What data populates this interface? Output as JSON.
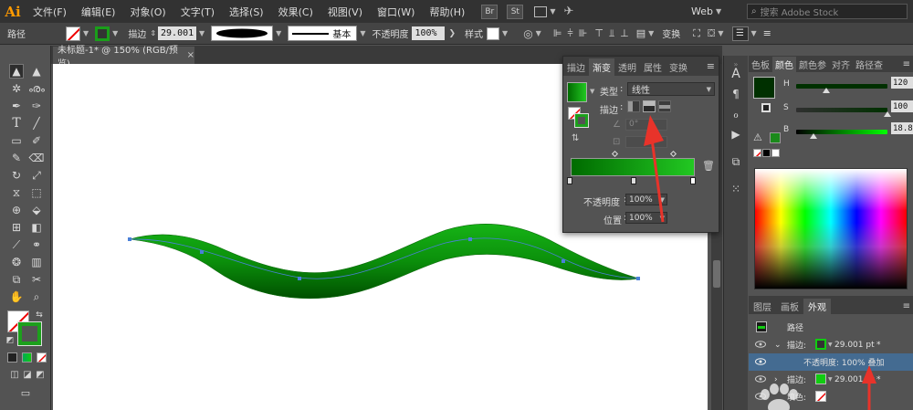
{
  "menubar": {
    "logo": "Ai",
    "items": [
      "文件(F)",
      "编辑(E)",
      "对象(O)",
      "文字(T)",
      "选择(S)",
      "效果(C)",
      "视图(V)",
      "窗口(W)",
      "帮助(H)"
    ],
    "badges": [
      "Br",
      "St"
    ],
    "workspace": "Web",
    "search_placeholder": "搜索 Adobe Stock"
  },
  "controlbar": {
    "object_type": "路径",
    "stroke_label": "描边",
    "stroke_value": "29.001",
    "brush_label": "基本",
    "opacity_label": "不透明度",
    "opacity_value": "100%",
    "style_label": "样式",
    "transform_label": "变换"
  },
  "document": {
    "tab_title": "未标题-1* @ 150% (RGB/预览)",
    "close_glyph": "×"
  },
  "gradient_panel": {
    "tabs": [
      "描边",
      "渐变",
      "透明",
      "属性",
      "变换"
    ],
    "active_tab": "渐变",
    "type_label": "类型",
    "type_value": "线性",
    "stroke_label": "描边",
    "angle_value": "0°",
    "opacity_label": "不透明度",
    "opacity_value": "100%",
    "location_label": "位置",
    "location_value": "100%",
    "stop_dark": "#006b00",
    "stop_light": "#22c822"
  },
  "color_panel": {
    "tabs": [
      "色板",
      "颜色",
      "颜色参",
      "对齐",
      "路径查"
    ],
    "active_tab": "颜色",
    "channels": [
      {
        "label": "H",
        "value": "120",
        "unit": "°",
        "fraction": 0.33
      },
      {
        "label": "S",
        "value": "100",
        "unit": "%",
        "fraction": 1.0
      },
      {
        "label": "B",
        "value": "18.82",
        "unit": "%",
        "fraction": 0.19
      }
    ],
    "current_color": "#003000"
  },
  "appearance_panel": {
    "tabs": [
      "图层",
      "画板",
      "外观"
    ],
    "active_tab": "外观",
    "title": "路径",
    "rows": [
      {
        "label": "描边:",
        "value": "29.001 pt",
        "mark": "*"
      },
      {
        "label": "不透明度: 100% 叠加",
        "value": "",
        "mark": ""
      },
      {
        "label": "描边:",
        "value": "29.001 pt",
        "mark": "*"
      },
      {
        "label": "填色:",
        "value": "",
        "mark": ""
      }
    ]
  },
  "colors": {
    "accent": "#ff9a00",
    "highlight_row": "#446b91",
    "arrow": "#e8332a"
  }
}
